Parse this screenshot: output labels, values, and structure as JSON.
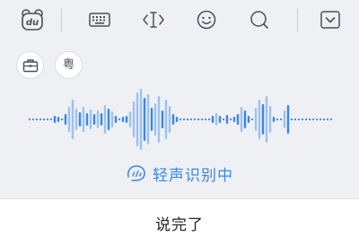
{
  "toolbar": {
    "items": [
      {
        "icon": "du-logo-icon",
        "label": "du"
      },
      {
        "icon": "keyboard-icon"
      },
      {
        "icon": "cursor-icon"
      },
      {
        "icon": "emoji-icon"
      },
      {
        "icon": "search-icon"
      },
      {
        "icon": "collapse-keyboard-icon"
      }
    ]
  },
  "chips": [
    {
      "icon": "briefcase-icon"
    },
    {
      "icon": "cantonese-icon",
      "label": "粤"
    }
  ],
  "voice": {
    "status": "轻声识别中",
    "accent_color": "#3a86e6"
  },
  "bottom": {
    "finish_label": "说完了"
  }
}
